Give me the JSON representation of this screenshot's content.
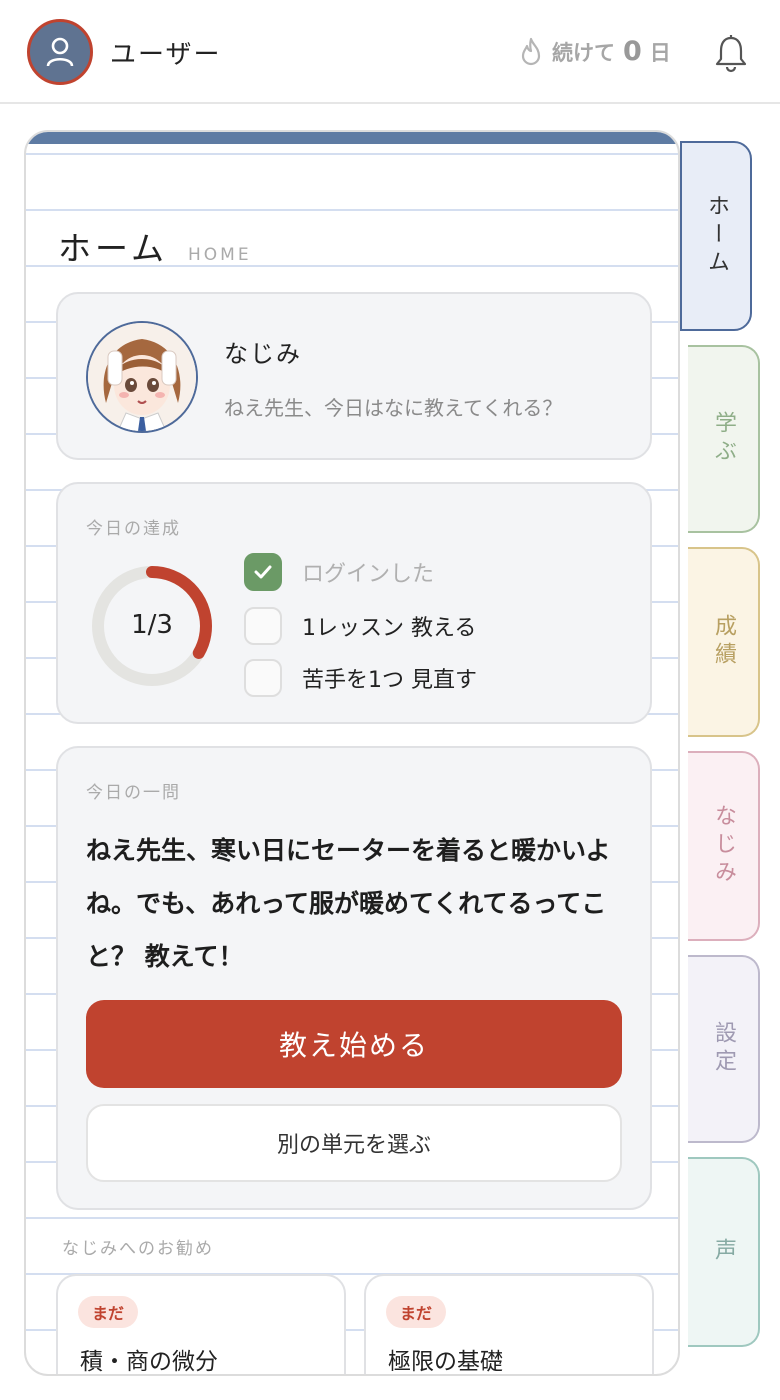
{
  "header": {
    "username": "ユーザー",
    "streak_prefix": "続けて",
    "streak_count": "0",
    "streak_suffix": "日"
  },
  "page": {
    "title": "ホーム",
    "title_en": "HOME"
  },
  "profile": {
    "name": "なじみ",
    "greeting": "ねえ先生、今日はなに教えてくれる？"
  },
  "goals": {
    "label": "今日の達成",
    "progress_text": "1/3",
    "progress_fraction": 0.333,
    "tasks": [
      {
        "label": "ログインした",
        "done": true
      },
      {
        "label": "1レッスン 教える",
        "done": false
      },
      {
        "label": "苦手を1つ 見直す",
        "done": false
      }
    ]
  },
  "question": {
    "label": "今日の一問",
    "text": "ねえ先生、寒い日にセーターを着ると暖かいよね。でも、あれって服が暖めてくれてるってこと？ 教えて！",
    "primary_button": "教え始める",
    "secondary_button": "別の単元を選ぶ"
  },
  "recommend": {
    "label": "なじみへのお勧め",
    "items": [
      {
        "badge": "まだ",
        "title": "積・商の微分"
      },
      {
        "badge": "まだ",
        "title": "極限の基礎"
      }
    ]
  },
  "tabs": [
    {
      "label": "ホーム",
      "active": true
    },
    {
      "label": "学ぶ"
    },
    {
      "label": "成績"
    },
    {
      "label": "なじみ"
    },
    {
      "label": "設定"
    },
    {
      "label": "声"
    }
  ],
  "colors": {
    "accent": "#c0432f",
    "notebook_top": "#5e7ba3",
    "done_green": "#6b9a66"
  }
}
